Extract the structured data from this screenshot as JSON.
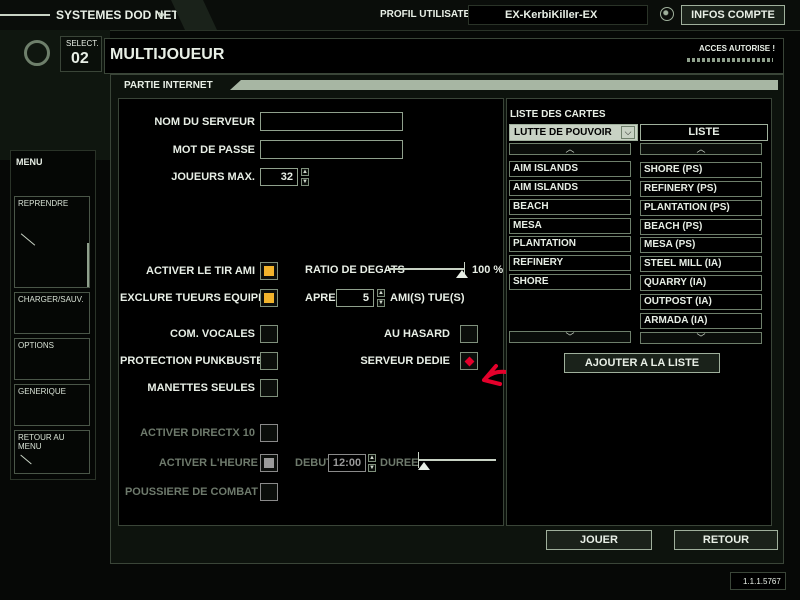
{
  "topbar": {
    "system": "SYSTEMES DOD net",
    "profile_label": "PROFIL UTILISATEUR",
    "profile_name": "EX-KerbiKiller-EX",
    "account_button": "INFOS COMPTE"
  },
  "select": {
    "label": "SELECT.",
    "number": "02"
  },
  "header": {
    "title": "MULTIJOUEUR",
    "access": "ACCES AUTORISE !"
  },
  "section": {
    "title": "PARTIE INTERNET"
  },
  "menu": {
    "title": "MENU",
    "items": [
      "REPRENDRE",
      "CHARGER/SAUV.",
      "OPTIONS",
      "GENERIQUE",
      "RETOUR AU MENU"
    ]
  },
  "form": {
    "server_name_label": "NOM DU SERVEUR",
    "server_name_value": "",
    "password_label": "MOT DE PASSE",
    "password_value": "",
    "max_players_label": "JOUEURS MAX.",
    "max_players_value": "32",
    "friendly_fire_label": "ACTIVER LE TIR AMI",
    "exclude_tk_label": "EXCLURE TUEURS EQUIPE",
    "voice_label": "COM. VOCALES",
    "punkbuster_label": "PROTECTION PUNKBUSTER",
    "controllers_label": "MANETTES SEULES",
    "directx_label": "ACTIVER DIRECTX 10",
    "time_label": "ACTIVER L'HEURE",
    "dust_label": "POUSSIERE DE COMBAT",
    "damage_ratio_label": "RATIO DE DEGATS",
    "damage_ratio_value": "100 %",
    "after_label": "APRES",
    "after_value": "5",
    "friend_kills_label": "AMI(S) TUE(S)",
    "random_label": "AU HASARD",
    "dedicated_label": "SERVEUR DEDIE",
    "start_label": "DEBUT",
    "start_value": "12:00",
    "duration_label": "DUREE"
  },
  "maps": {
    "title": "LISTE DES CARTES",
    "mode": "LUTTE DE POUVOIR",
    "list_header": "LISTE",
    "available": [
      "AIM ISLANDS",
      "AIM ISLANDS",
      "BEACH",
      "MESA",
      "PLANTATION",
      "REFINERY",
      "SHORE"
    ],
    "selected": [
      "SHORE (PS)",
      "REFINERY (PS)",
      "PLANTATION (PS)",
      "BEACH (PS)",
      "MESA (PS)",
      "STEEL MILL (IA)",
      "QUARRY (IA)",
      "OUTPOST (IA)",
      "ARMADA (IA)"
    ],
    "add_button": "AJOUTER A LA LISTE"
  },
  "footer": {
    "play": "JOUER",
    "back": "RETOUR",
    "version": "1.1.1.5767"
  },
  "colors": {
    "accent": "#f1b32c",
    "panel": "#0d130d",
    "annotation": "#e4002b"
  }
}
